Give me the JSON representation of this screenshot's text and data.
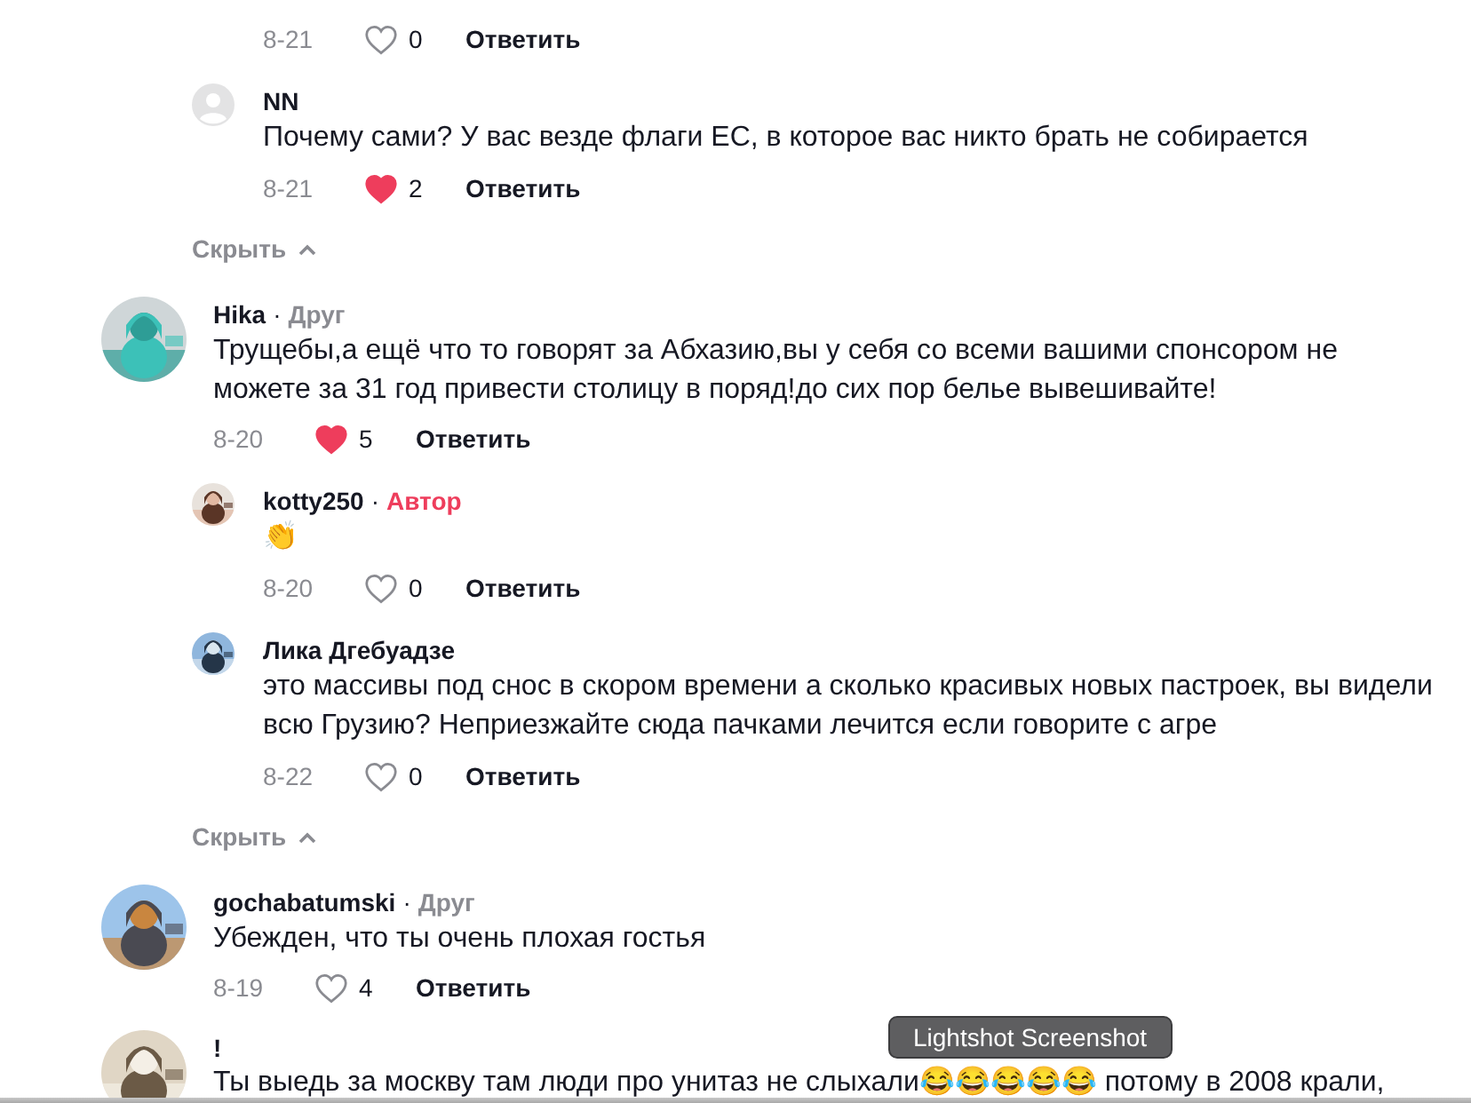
{
  "feed": [
    {
      "kind": "actions",
      "date": "8-21",
      "likes": "0",
      "liked": false,
      "reply_label": "Ответить"
    },
    {
      "kind": "reply",
      "avatar": {
        "kind": "default"
      },
      "author": "NN",
      "text": "Почему сами? У вас везде флаги ЕС, в которое вас никто брать не собирается",
      "date": "8-21",
      "likes": "2",
      "liked": true,
      "reply_label": "Ответить"
    },
    {
      "kind": "hide",
      "label": "Скрыть"
    },
    {
      "kind": "comment",
      "author": "Hika",
      "badge": {
        "separator": "·",
        "label": "Друг",
        "kind": "friend"
      },
      "text": "Трущебы,а ещё что то говорят за Абхазию,вы у себя со всеми вашими спонсором не можете за 31 год привести столицу в поряд!до сих пор белье вывешивайте!",
      "date": "8-20",
      "likes": "5",
      "liked": true,
      "reply_label": "Ответить"
    },
    {
      "kind": "reply",
      "author": "kotty250",
      "badge": {
        "separator": "·",
        "label": "Автор",
        "kind": "author"
      },
      "text": "👏",
      "date": "8-20",
      "likes": "0",
      "liked": false,
      "reply_label": "Ответить"
    },
    {
      "kind": "reply",
      "author": "Лика Дгебуадзе",
      "text": "это массивы под снос в скором времени а сколько красивых новых пастроек, вы видели всю Грузию? Неприезжайте сюда пачками лечится если говорите с агре",
      "date": "8-22",
      "likes": "0",
      "liked": false,
      "reply_label": "Ответить"
    },
    {
      "kind": "hide",
      "label": "Скрыть"
    },
    {
      "kind": "comment",
      "author": "gochabatumski",
      "badge": {
        "separator": "·",
        "label": "Друг",
        "kind": "friend"
      },
      "text": "Убежден, что ты очень плохая гостья",
      "date": "8-19",
      "likes": "4",
      "liked": false,
      "reply_label": "Ответить"
    },
    {
      "kind": "comment",
      "author": "!",
      "text": "Ты выедь за москву там люди про унитаз не слыхали😂😂😂😂😂 потому в 2008 крали,"
    }
  ],
  "tooltip": {
    "text": "Lightshot Screenshot"
  }
}
